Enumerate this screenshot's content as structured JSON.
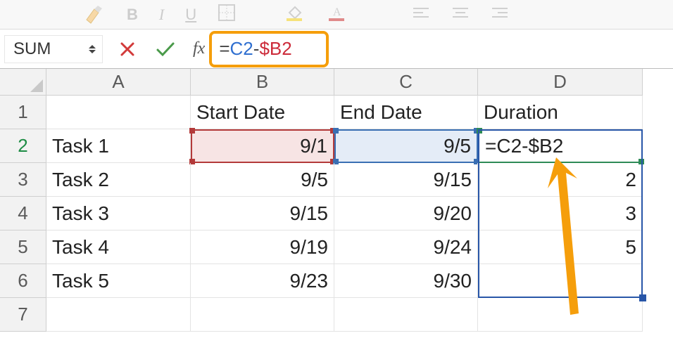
{
  "toolbar": {
    "bold_hint": "B",
    "italic_hint": "I",
    "underline_hint": "U"
  },
  "formula_bar": {
    "name_box": "SUM",
    "fx_label": "fx",
    "formula_eq": "=",
    "formula_c2": "C2",
    "formula_op": "-",
    "formula_b2": "$B2"
  },
  "columns": {
    "A": "A",
    "B": "B",
    "C": "C",
    "D": "D"
  },
  "row_labels": {
    "1": "1",
    "2": "2",
    "3": "3",
    "4": "4",
    "5": "5",
    "6": "6",
    "7": "7"
  },
  "grid": {
    "r1": {
      "A": "",
      "B": "Start Date",
      "C": "End Date",
      "D": "Duration"
    },
    "r2": {
      "A": "Task 1",
      "B": "9/1",
      "C": "9/5",
      "D": "=C2-$B2"
    },
    "r3": {
      "A": "Task 2",
      "B": "9/5",
      "C": "9/15",
      "D": "2"
    },
    "r4": {
      "A": "Task 3",
      "B": "9/15",
      "C": "9/20",
      "D": "3"
    },
    "r5": {
      "A": "Task 4",
      "B": "9/19",
      "C": "9/24",
      "D": "5"
    },
    "r6": {
      "A": "Task 5",
      "B": "9/23",
      "C": "9/30",
      "D": ""
    },
    "r7": {
      "A": "",
      "B": "",
      "C": "",
      "D": ""
    }
  },
  "colors": {
    "highlight_orange": "#f59e0b",
    "ref_red": "#b33a3a",
    "ref_blue": "#3a6fb3",
    "active_green": "#2e8b57",
    "selection_blue": "#2856a8"
  }
}
